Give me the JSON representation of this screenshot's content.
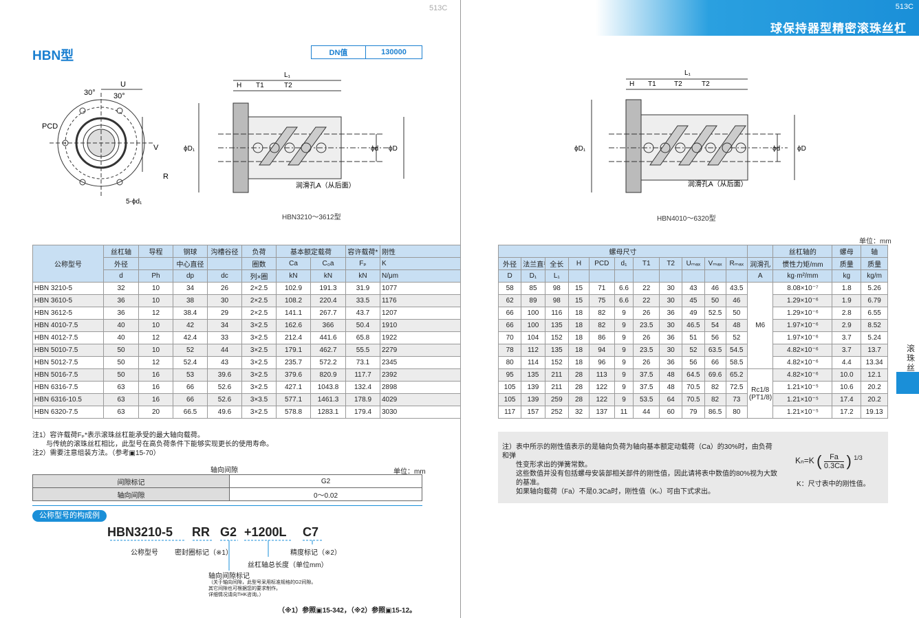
{
  "left_page_no": "513C",
  "right_page_no": "513C",
  "brand_title": "球保持器型精密滚珠丝杠",
  "model_title": "HBN型",
  "dn": {
    "label": "DN值",
    "value": "130000"
  },
  "drawing_labels": {
    "u": "U",
    "angle1": "30°",
    "angle2": "30°",
    "pcd": "PCD",
    "v": "V",
    "r": "R",
    "holes": "5-ϕd₁",
    "h": "H",
    "t1": "T1",
    "t2": "T2",
    "l1": "L₁",
    "d1": "ϕD₁",
    "dd": "ϕd",
    "D": "ϕD",
    "lube": "润滑孔A（从后面）"
  },
  "caption_left": "HBN3210～3612型",
  "caption_right": "HBN4010～6320型",
  "unit_mm": "单位：mm",
  "side_text": "滚珠丝杠",
  "table": {
    "header1": [
      "公称型号",
      "丝杠轴",
      "导程",
      "钢球",
      "沟槽谷径",
      "负荷",
      "基本额定载荷",
      "容许载荷*",
      "刚性",
      "螺母尺寸",
      "丝杠轴的",
      "螺母",
      "轴"
    ],
    "header2": [
      "外径",
      "",
      "中心直径",
      "",
      "圈数",
      "Ca",
      "C₀a",
      "Fₚ",
      "K",
      "外径",
      "法兰直径",
      "全长",
      "H",
      "PCD",
      "d₁",
      "T1",
      "T2",
      "Uₘₐₓ",
      "Vₘₐₓ",
      "Rₘₐₓ",
      "润滑孔",
      "惯性力矩/mm",
      "质量",
      "质量"
    ],
    "header3": [
      "d",
      "Ph",
      "dp",
      "dc",
      "列×圈",
      "kN",
      "kN",
      "kN",
      "N/μm",
      "D",
      "D₁",
      "L₁",
      "",
      "",
      "",
      "",
      "",
      "",
      "",
      "",
      "A",
      "kg·m²/mm",
      "kg",
      "kg/m"
    ],
    "rows": [
      [
        "HBN 3210-5",
        "32",
        "10",
        "34",
        "26",
        "2×2.5",
        "102.9",
        "191.3",
        "31.9",
        "1077",
        "58",
        "85",
        "98",
        "15",
        "71",
        "6.6",
        "22",
        "30",
        "43",
        "46",
        "43.5",
        "M6",
        "8.08×10⁻⁷",
        "1.8",
        "5.26"
      ],
      [
        "HBN 3610-5",
        "36",
        "10",
        "38",
        "30",
        "2×2.5",
        "108.2",
        "220.4",
        "33.5",
        "1176",
        "62",
        "89",
        "98",
        "15",
        "75",
        "6.6",
        "22",
        "30",
        "45",
        "50",
        "46",
        "",
        "1.29×10⁻⁶",
        "1.9",
        "6.79"
      ],
      [
        "HBN 3612-5",
        "36",
        "12",
        "38.4",
        "29",
        "2×2.5",
        "141.1",
        "267.7",
        "43.7",
        "1207",
        "66",
        "100",
        "116",
        "18",
        "82",
        "9",
        "26",
        "36",
        "49",
        "52.5",
        "50",
        "",
        "1.29×10⁻⁶",
        "2.8",
        "6.55"
      ],
      [
        "HBN 4010-7.5",
        "40",
        "10",
        "42",
        "34",
        "3×2.5",
        "162.6",
        "366",
        "50.4",
        "1910",
        "66",
        "100",
        "135",
        "18",
        "82",
        "9",
        "23.5",
        "30",
        "46.5",
        "54",
        "48",
        "",
        "1.97×10⁻⁶",
        "2.9",
        "8.52"
      ],
      [
        "HBN 4012-7.5",
        "40",
        "12",
        "42.4",
        "33",
        "3×2.5",
        "212.4",
        "441.6",
        "65.8",
        "1922",
        "70",
        "104",
        "152",
        "18",
        "86",
        "9",
        "26",
        "36",
        "51",
        "56",
        "52",
        "",
        "1.97×10⁻⁶",
        "3.7",
        "5.24"
      ],
      [
        "HBN 5010-7.5",
        "50",
        "10",
        "52",
        "44",
        "3×2.5",
        "179.1",
        "462.7",
        "55.5",
        "2279",
        "78",
        "112",
        "135",
        "18",
        "94",
        "9",
        "23.5",
        "30",
        "52",
        "63.5",
        "54.5",
        "",
        "4.82×10⁻⁶",
        "3.7",
        "13.7"
      ],
      [
        "HBN 5012-7.5",
        "50",
        "12",
        "52.4",
        "43",
        "3×2.5",
        "235.7",
        "572.2",
        "73.1",
        "2345",
        "80",
        "114",
        "152",
        "18",
        "96",
        "9",
        "26",
        "36",
        "56",
        "66",
        "58.5",
        "",
        "4.82×10⁻⁶",
        "4.4",
        "13.34"
      ],
      [
        "HBN 5016-7.5",
        "50",
        "16",
        "53",
        "39.6",
        "3×2.5",
        "379.6",
        "820.9",
        "117.7",
        "2392",
        "95",
        "135",
        "211",
        "28",
        "113",
        "9",
        "37.5",
        "48",
        "64.5",
        "69.6",
        "65.2",
        "Rc1/8 (PT1/8)",
        "4.82×10⁻⁶",
        "10.0",
        "12.1"
      ],
      [
        "HBN 6316-7.5",
        "63",
        "16",
        "66",
        "52.6",
        "3×2.5",
        "427.1",
        "1043.8",
        "132.4",
        "2898",
        "105",
        "139",
        "211",
        "28",
        "122",
        "9",
        "37.5",
        "48",
        "70.5",
        "82",
        "72.5",
        "",
        "1.21×10⁻⁵",
        "10.6",
        "20.2"
      ],
      [
        "HBN 6316-10.5",
        "63",
        "16",
        "66",
        "52.6",
        "3×3.5",
        "577.1",
        "1461.3",
        "178.9",
        "4029",
        "105",
        "139",
        "259",
        "28",
        "122",
        "9",
        "53.5",
        "64",
        "70.5",
        "82",
        "73",
        "",
        "1.21×10⁻⁵",
        "17.4",
        "20.2"
      ],
      [
        "HBN 6320-7.5",
        "63",
        "20",
        "66.5",
        "49.6",
        "3×2.5",
        "578.8",
        "1283.1",
        "179.4",
        "3030",
        "117",
        "157",
        "252",
        "32",
        "137",
        "11",
        "44",
        "60",
        "79",
        "86.5",
        "80",
        "",
        "1.21×10⁻⁵",
        "17.2",
        "19.13"
      ]
    ]
  },
  "notes_left": [
    "注1）容许载荷Fₚ*表示滚珠丝杠能承受的最大轴向载荷。",
    "　　与传统的滚珠丝杠相比，此型号在高负荷条件下能够实现更长的使用寿命。",
    "注2）需要注意组装方法。（参考▣15-70）"
  ],
  "notes_right": [
    "注）表中所示的刚性值表示的是轴向负荷为轴向基本额定动载荷（Ca）的30%时，由负荷和弹",
    "　　性变形求出的弹簧常数。",
    "　　这些数值并没有包括螺母安装部相关部件的刚性值，因此请将表中数值的80%视为大致",
    "　　的基准。",
    "　　如果轴向载荷（Fa）不是0.3Ca时，刚性值（Kₙ）可由下式求出。"
  ],
  "formula": {
    "lhs": "Kₙ=K",
    "num": "Fa",
    "den": "0.3Ca",
    "exp": "1/3",
    "k_note": "K：尺寸表中的刚性值。"
  },
  "gap_table": {
    "title": "轴向间隙",
    "unit": "单位：mm",
    "row1": [
      "间隙标记",
      "G2"
    ],
    "row2": [
      "轴向间隙",
      "0～0.02"
    ]
  },
  "composition": {
    "title": "公称型号的构成例",
    "code": [
      "HBN3210-5",
      "RR",
      "G2",
      "+1200L",
      "C7"
    ],
    "labels": [
      "公称型号",
      "密封圈标记（※1）",
      "丝杠轴总长度（单位mm）",
      "精度标记（※2）",
      "轴向间隙标记"
    ],
    "small": [
      "（关于轴向间隙，此型号采用标准规格的G2间隙。",
      "其它间隙也可根据您的要求制作。",
      "详细情况请向THK咨询。）"
    ],
    "refs": "（※1）参照▣15-342，（※2）参照▣15-12。"
  }
}
